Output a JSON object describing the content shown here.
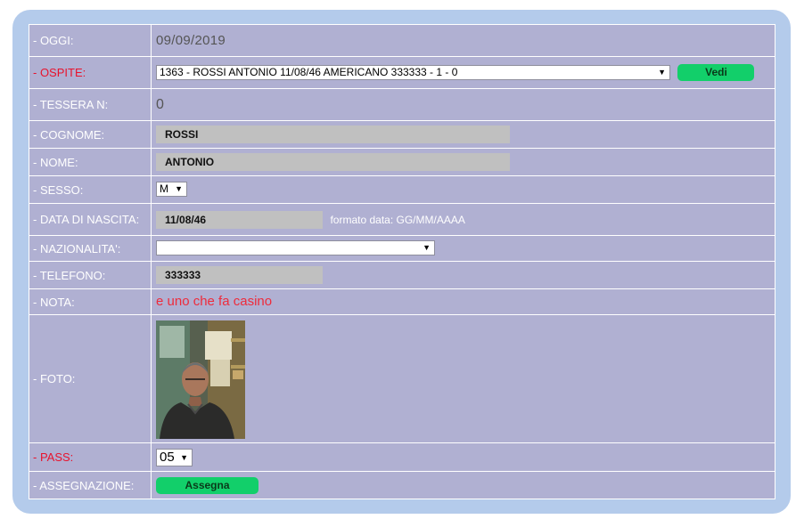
{
  "labels": {
    "oggi": "- OGGI:",
    "ospite": "- OSPITE:",
    "tessera": "- TESSERA N:",
    "cognome": "- COGNOME:",
    "nome": "- NOME:",
    "sesso": "- SESSO:",
    "nascita": "- DATA DI NASCITA:",
    "nazionalita": "- NAZIONALITA':",
    "telefono": "- TELEFONO:",
    "nota": "- NOTA:",
    "foto": "- FOTO:",
    "pass": "- PASS:",
    "assegnazione": "- ASSEGNAZIONE:"
  },
  "values": {
    "oggi": "09/09/2019",
    "ospite_selected": "1363 - ROSSI ANTONIO 11/08/46 AMERICANO 333333 - 1 - 0",
    "tessera": "0",
    "cognome": "ROSSI",
    "nome": "ANTONIO",
    "sesso": "M",
    "nascita": "11/08/46",
    "nascita_hint": "formato data: GG/MM/AAAA",
    "nazionalita": "",
    "telefono": "333333",
    "nota": "e uno che fa casino",
    "pass": "05"
  },
  "buttons": {
    "vedi": "Vedi",
    "assegna": "Assegna"
  },
  "icons": {
    "dropdown": "▼"
  },
  "colors": {
    "panel_border": "#b4cbeb",
    "cell_bg": "#b0b0d2",
    "required_label": "#e8132d",
    "button": "#12cf6a",
    "note": "#ee2b3b"
  }
}
